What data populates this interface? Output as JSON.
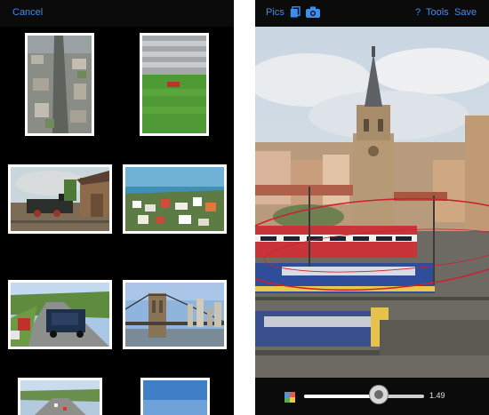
{
  "left_screen": {
    "cancel_label": "Cancel",
    "thumbnails": [
      {
        "name": "city-aerial"
      },
      {
        "name": "stadium-field"
      },
      {
        "name": "steam-train"
      },
      {
        "name": "harbor-town"
      },
      {
        "name": "highway-truck"
      },
      {
        "name": "brooklyn-bridge"
      },
      {
        "name": "highway-road"
      },
      {
        "name": "sky-photo"
      }
    ]
  },
  "right_screen": {
    "pics_label": "Pics",
    "help_label": "?",
    "tools_label": "Tools",
    "save_label": "Save",
    "blur_slider": {
      "value": 0.62,
      "value_label": "1.49"
    },
    "icons": {
      "pics": "copy-icon",
      "camera": "camera-icon",
      "palette": "color-palette-icon"
    }
  },
  "colors": {
    "accent": "#3d8ef0",
    "bar": "#0b0b0b",
    "frame": "#ffffff",
    "focus_ellipse": "#d0202a"
  }
}
